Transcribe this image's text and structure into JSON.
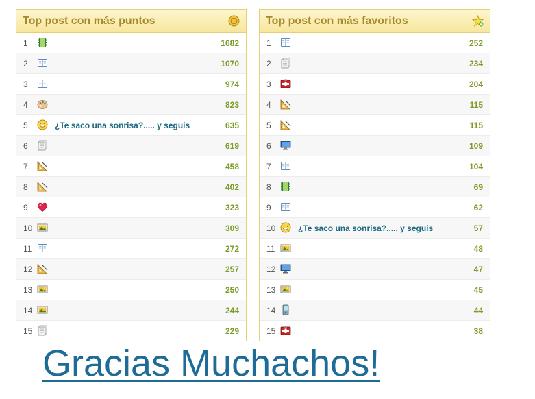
{
  "left_panel": {
    "title": "Top post con más puntos",
    "header_icon": "coin-icon",
    "rows": [
      {
        "rank": "1",
        "icon": "film-icon",
        "title": "",
        "value": "1682"
      },
      {
        "rank": "2",
        "icon": "book-icon",
        "title": "",
        "value": "1070"
      },
      {
        "rank": "3",
        "icon": "book-icon",
        "title": "",
        "value": "974"
      },
      {
        "rank": "4",
        "icon": "palette-icon",
        "title": "",
        "value": "823"
      },
      {
        "rank": "5",
        "icon": "smiley-icon",
        "title": "¿Te saco una sonrisa?..... y seguis",
        "value": "635"
      },
      {
        "rank": "6",
        "icon": "document-icon",
        "title": "",
        "value": "619"
      },
      {
        "rank": "7",
        "icon": "ruler-icon",
        "title": "",
        "value": "458"
      },
      {
        "rank": "8",
        "icon": "ruler-icon",
        "title": "",
        "value": "402"
      },
      {
        "rank": "9",
        "icon": "heart-icon",
        "title": "",
        "value": "323"
      },
      {
        "rank": "10",
        "icon": "picture-icon",
        "title": "",
        "value": "309"
      },
      {
        "rank": "11",
        "icon": "book-icon",
        "title": "",
        "value": "272"
      },
      {
        "rank": "12",
        "icon": "ruler-icon",
        "title": "",
        "value": "257"
      },
      {
        "rank": "13",
        "icon": "picture-icon",
        "title": "",
        "value": "250"
      },
      {
        "rank": "14",
        "icon": "picture-icon",
        "title": "",
        "value": "244"
      },
      {
        "rank": "15",
        "icon": "document-icon",
        "title": "",
        "value": "229"
      }
    ]
  },
  "right_panel": {
    "title": "Top post con más favoritos",
    "header_icon": "star-add-icon",
    "rows": [
      {
        "rank": "1",
        "icon": "book-icon",
        "title": "",
        "value": "252"
      },
      {
        "rank": "2",
        "icon": "document-icon",
        "title": "",
        "value": "234"
      },
      {
        "rank": "3",
        "icon": "first-aid-icon",
        "title": "",
        "value": "204"
      },
      {
        "rank": "4",
        "icon": "ruler-icon",
        "title": "",
        "value": "115"
      },
      {
        "rank": "5",
        "icon": "ruler-icon",
        "title": "",
        "value": "115"
      },
      {
        "rank": "6",
        "icon": "monitor-icon",
        "title": "",
        "value": "109"
      },
      {
        "rank": "7",
        "icon": "book-icon",
        "title": "",
        "value": "104"
      },
      {
        "rank": "8",
        "icon": "film-icon",
        "title": "",
        "value": "69"
      },
      {
        "rank": "9",
        "icon": "book-icon",
        "title": "",
        "value": "62"
      },
      {
        "rank": "10",
        "icon": "smiley-icon",
        "title": "¿Te saco una sonrisa?..... y seguis",
        "value": "57"
      },
      {
        "rank": "11",
        "icon": "picture-icon",
        "title": "",
        "value": "48"
      },
      {
        "rank": "12",
        "icon": "monitor-icon",
        "title": "",
        "value": "47"
      },
      {
        "rank": "13",
        "icon": "picture-icon",
        "title": "",
        "value": "45"
      },
      {
        "rank": "14",
        "icon": "phone-icon",
        "title": "",
        "value": "44"
      },
      {
        "rank": "15",
        "icon": "first-aid-icon",
        "title": "",
        "value": "38"
      }
    ]
  },
  "footer": {
    "caption": "Gracias Muchachos!"
  }
}
